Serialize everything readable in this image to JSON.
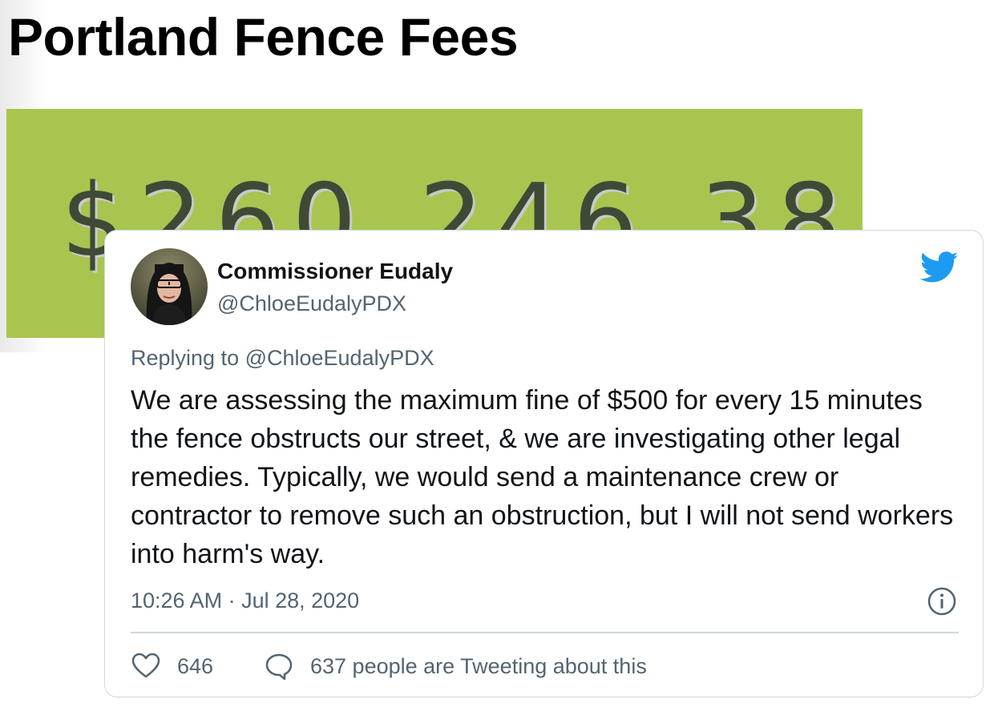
{
  "page": {
    "title": "Portland Fence Fees"
  },
  "counter": {
    "value": "$260 246 38"
  },
  "tweet": {
    "author_name": "Commissioner Eudaly",
    "author_handle": "@ChloeEudalyPDX",
    "reply_to": "Replying to @ChloeEudalyPDX",
    "text": "We are assessing the maximum fine of $500 for every 15 minutes the fence obstructs our street, & we are investigating other legal remedies. Typically, we would send a maintenance crew or contractor to remove such an obstruction, but I will not send workers into harm's way.",
    "timestamp": "10:26 AM · Jul 28, 2020",
    "like_count": "646",
    "discussion_text": "637 people are Tweeting about this"
  },
  "icons": {
    "brand": "twitter-bird-icon",
    "info": "info-icon",
    "like": "heart-icon",
    "discussion": "speech-bubble-icon"
  },
  "colors": {
    "counter_background": "#a8c550",
    "counter_text": "#3f4a36",
    "twitter_blue": "#1d9bf0",
    "secondary_text": "#536471",
    "primary_text": "#0f1419",
    "card_border": "#cfd9de"
  }
}
